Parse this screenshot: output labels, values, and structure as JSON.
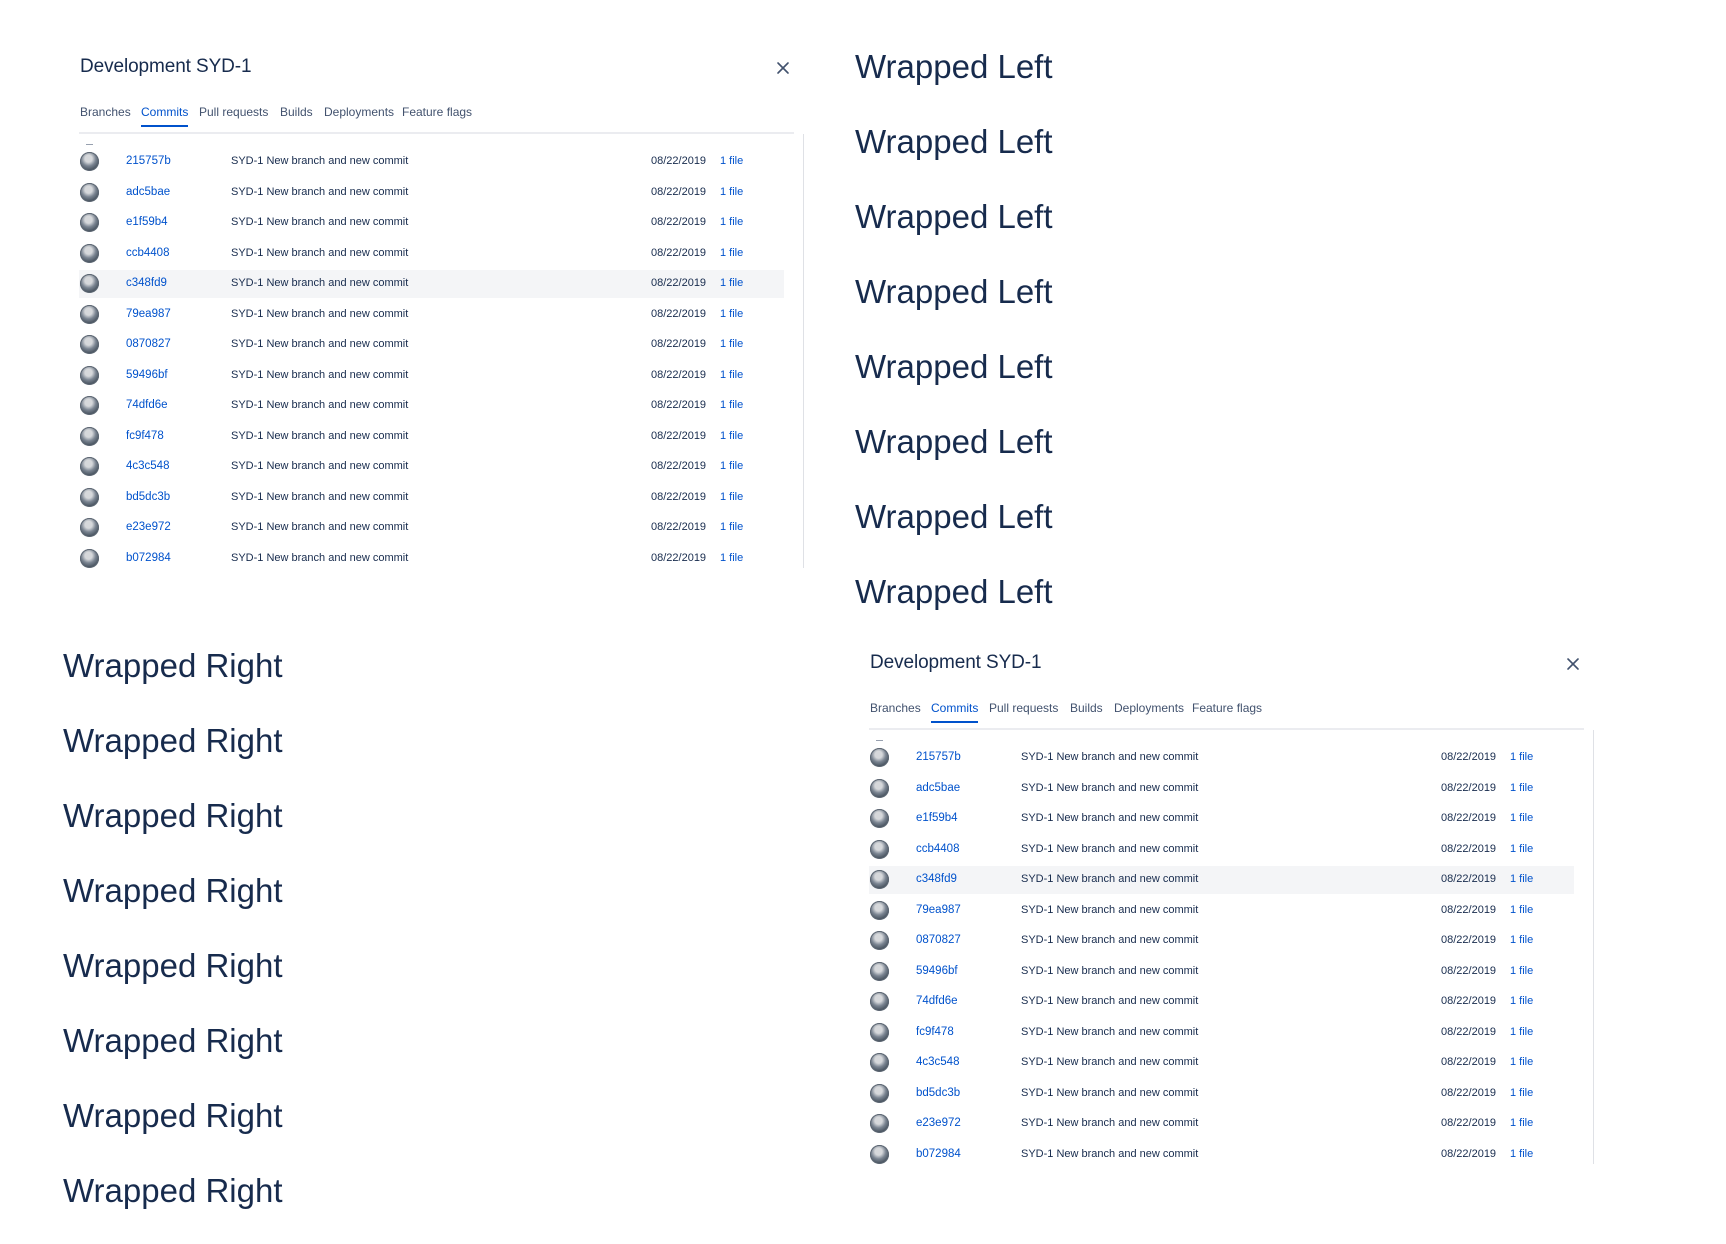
{
  "dialog": {
    "title": "Development SYD-1",
    "tabs": [
      {
        "label": "Branches",
        "active": false
      },
      {
        "label": "Commits",
        "active": true
      },
      {
        "label": "Pull requests",
        "active": false
      },
      {
        "label": "Builds",
        "active": false
      },
      {
        "label": "Deployments",
        "active": false
      },
      {
        "label": "Feature flags",
        "active": false
      }
    ],
    "commits": [
      {
        "hash": "215757b",
        "message": "SYD-1 New branch and new commit",
        "date": "08/22/2019",
        "files": "1 file"
      },
      {
        "hash": "adc5bae",
        "message": "SYD-1 New branch and new commit",
        "date": "08/22/2019",
        "files": "1 file"
      },
      {
        "hash": "e1f59b4",
        "message": "SYD-1 New branch and new commit",
        "date": "08/22/2019",
        "files": "1 file"
      },
      {
        "hash": "ccb4408",
        "message": "SYD-1 New branch and new commit",
        "date": "08/22/2019",
        "files": "1 file"
      },
      {
        "hash": "c348fd9",
        "message": "SYD-1 New branch and new commit",
        "date": "08/22/2019",
        "files": "1 file"
      },
      {
        "hash": "79ea987",
        "message": "SYD-1 New branch and new commit",
        "date": "08/22/2019",
        "files": "1 file"
      },
      {
        "hash": "0870827",
        "message": "SYD-1 New branch and new commit",
        "date": "08/22/2019",
        "files": "1 file"
      },
      {
        "hash": "59496bf",
        "message": "SYD-1 New branch and new commit",
        "date": "08/22/2019",
        "files": "1 file"
      },
      {
        "hash": "74dfd6e",
        "message": "SYD-1 New branch and new commit",
        "date": "08/22/2019",
        "files": "1 file"
      },
      {
        "hash": "fc9f478",
        "message": "SYD-1 New branch and new commit",
        "date": "08/22/2019",
        "files": "1 file"
      },
      {
        "hash": "4c3c548",
        "message": "SYD-1 New branch and new commit",
        "date": "08/22/2019",
        "files": "1 file"
      },
      {
        "hash": "bd5dc3b",
        "message": "SYD-1 New branch and new commit",
        "date": "08/22/2019",
        "files": "1 file"
      },
      {
        "hash": "e23e972",
        "message": "SYD-1 New branch and new commit",
        "date": "08/22/2019",
        "files": "1 file"
      },
      {
        "hash": "b072984",
        "message": "SYD-1 New branch and new commit",
        "date": "08/22/2019",
        "files": "1 file"
      }
    ],
    "highlighted_commit_index": 4,
    "close_icon": "close-icon"
  },
  "wrapped_left": [
    "Wrapped Left",
    "Wrapped Left",
    "Wrapped Left",
    "Wrapped Left",
    "Wrapped Left",
    "Wrapped Left",
    "Wrapped Left",
    "Wrapped Left"
  ],
  "wrapped_right": [
    "Wrapped Right",
    "Wrapped Right",
    "Wrapped Right",
    "Wrapped Right",
    "Wrapped Right",
    "Wrapped Right",
    "Wrapped Right",
    "Wrapped Right"
  ],
  "colors": {
    "text": "#172b4d",
    "link": "#0052cc",
    "tab_inactive": "#42526e",
    "row_highlight": "#f4f5f7",
    "divider": "#ebecf0"
  }
}
